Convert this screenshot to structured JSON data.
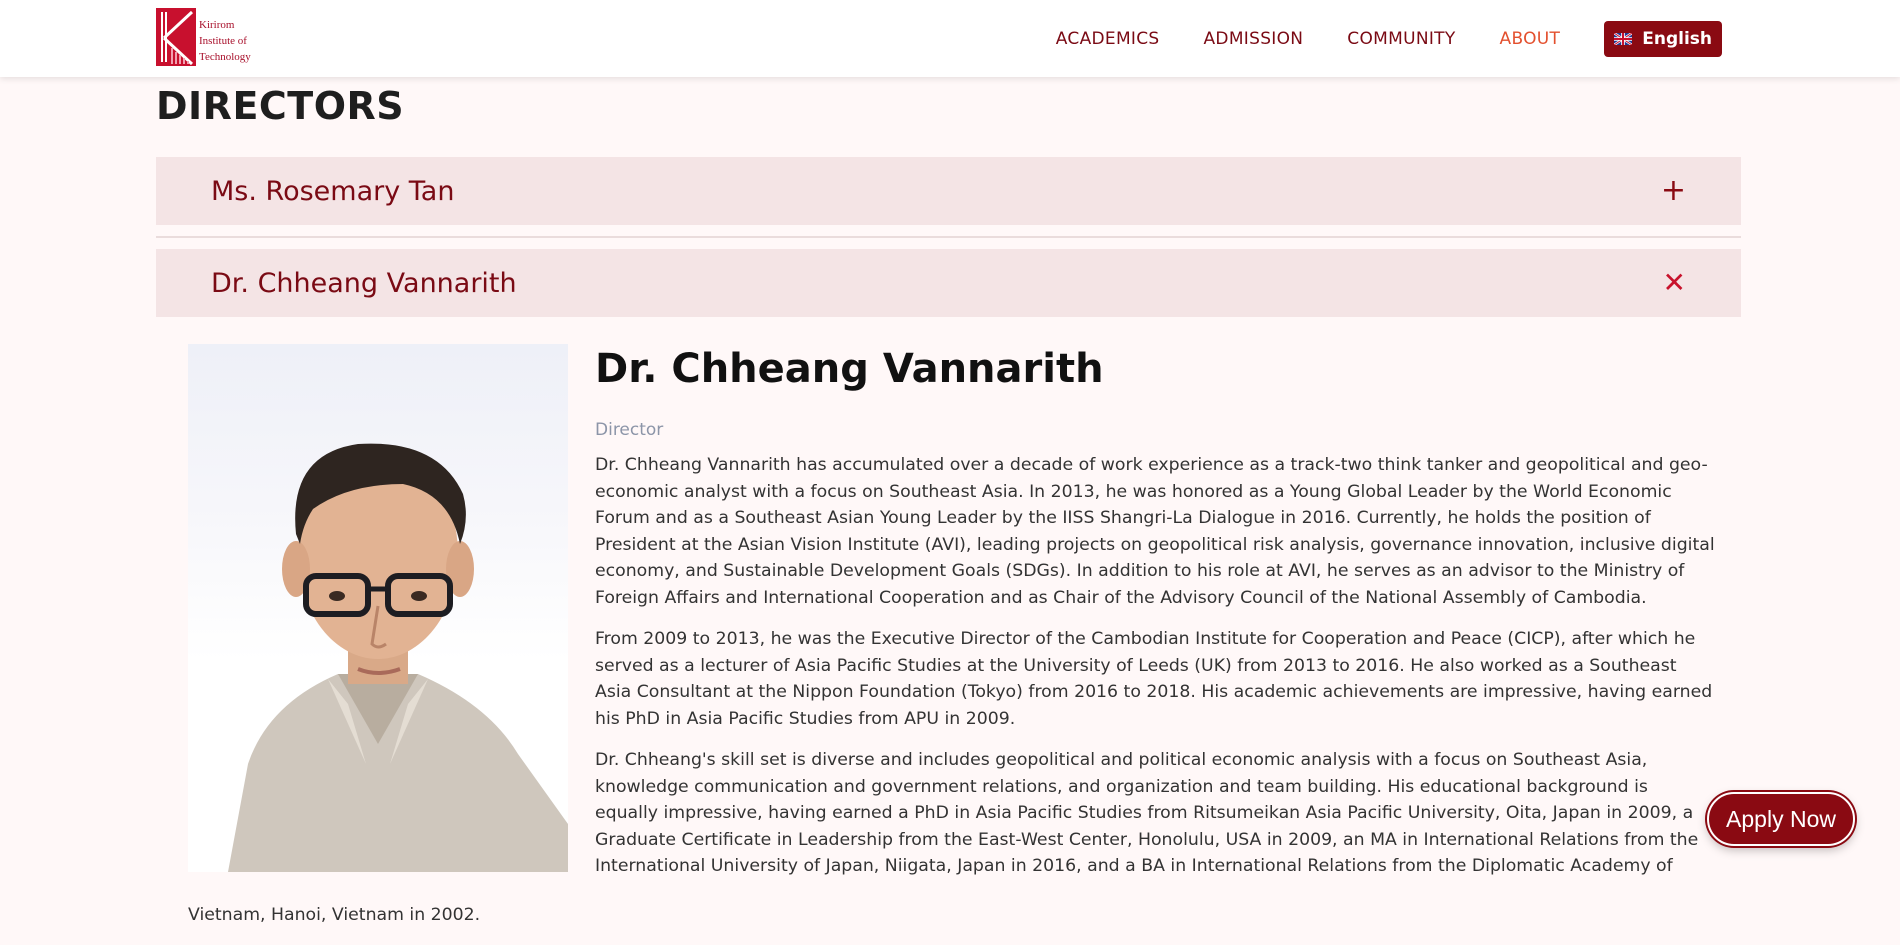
{
  "header": {
    "logo_lines": [
      "Kirirom",
      "Institute of",
      "Technology"
    ],
    "nav": [
      {
        "label": "ACADEMICS"
      },
      {
        "label": "ADMISSION"
      },
      {
        "label": "COMMUNITY"
      },
      {
        "label": "ABOUT"
      }
    ],
    "language": "English"
  },
  "section_title": "DIRECTORS",
  "accordion": [
    {
      "name": "Ms. Rosemary Tan",
      "icon": "+"
    },
    {
      "name": "Dr. Chheang Vannarith",
      "icon": "✕"
    }
  ],
  "profile": {
    "name": "Dr. Chheang Vannarith",
    "role": "Director",
    "paragraphs": [
      "Dr. Chheang Vannarith has accumulated over a decade of work experience as a track-two think tanker and geopolitical and geo-economic analyst with a focus on Southeast Asia. In 2013, he was honored as a Young Global Leader by the World Economic Forum and as a Southeast Asian Young Leader by the IISS Shangri-La Dialogue in 2016. Currently, he holds the position of President at the Asian Vision Institute (AVI), leading projects on geopolitical risk analysis, governance innovation, inclusive digital economy, and Sustainable Development Goals (SDGs). In addition to his role at AVI, he serves as an advisor to the Ministry of Foreign Affairs and International Cooperation and as Chair of the Advisory Council of the National Assembly of Cambodia.",
      "From 2009 to 2013, he was the Executive Director of the Cambodian Institute for Cooperation and Peace (CICP), after which he served as a lecturer of Asia Pacific Studies at the University of Leeds (UK) from 2013 to 2016. He also worked as a Southeast Asia Consultant at the Nippon Foundation (Tokyo) from 2016 to 2018. His academic achievements are impressive, having earned his PhD in Asia Pacific Studies from APU in 2009.",
      "Dr. Chheang's skill set is diverse and includes geopolitical and political economic analysis with a focus on Southeast Asia, knowledge communication and government relations, and organization and team building. His educational background is equally impressive, having earned a PhD in Asia Pacific Studies from Ritsumeikan Asia Pacific University, Oita, Japan in 2009, a Graduate Certificate in Leadership from the East-West Center, Honolulu, USA in 2009, an MA in International Relations from the International University of Japan, Niigata, Japan in 2016, and a BA in International Relations from the Diplomatic Academy of"
    ],
    "tail": "Vietnam, Hanoi, Vietnam in 2002."
  },
  "apply_button": "Apply Now",
  "colors": {
    "brand": "#8a0a12",
    "nav_text": "#7a0a14",
    "nav_active": "#e3502e",
    "accordion_bg": "#f4e4e5",
    "page_bg": "#fff8f8",
    "role_text": "#8c95a8"
  },
  "icons": [
    "kit-logo-icon",
    "uk-flag-icon",
    "plus-icon",
    "close-icon"
  ]
}
